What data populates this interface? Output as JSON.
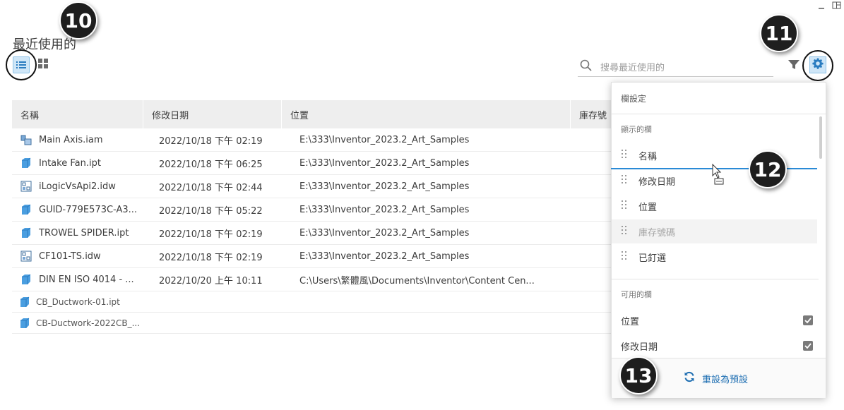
{
  "window": {
    "minimize_icon": "minimize-icon",
    "restore_icon": "restore-icon"
  },
  "page_title": "最近使用的",
  "view_toggle": {
    "list_icon": "list-view-icon",
    "grid_icon": "grid-view-icon"
  },
  "search": {
    "placeholder": "搜尋最近使用的"
  },
  "callouts": {
    "c10": "10",
    "c11": "11",
    "c12": "12",
    "c13": "13"
  },
  "table": {
    "headers": {
      "name": "名稱",
      "modified": "修改日期",
      "location": "位置",
      "part_no": "庫存號"
    },
    "rows": [
      {
        "icon": "assembly-icon",
        "name": "Main Axis.iam",
        "modified": "2022/10/18 下午 02:19",
        "location": "E:\\333\\Inventor_2023.2_Art_Samples"
      },
      {
        "icon": "part-icon",
        "name": "Intake Fan.ipt",
        "modified": "2022/10/18 下午 06:25",
        "location": "E:\\333\\Inventor_2023.2_Art_Samples"
      },
      {
        "icon": "drawing-icon",
        "name": "iLogicVsApi2.idw",
        "modified": "2022/10/18 下午 02:44",
        "location": "E:\\333\\Inventor_2023.2_Art_Samples"
      },
      {
        "icon": "part-icon",
        "name": "GUID-779E573C-A3...",
        "modified": "2022/10/18 下午 05:22",
        "location": "E:\\333\\Inventor_2023.2_Art_Samples"
      },
      {
        "icon": "part-icon",
        "name": "TROWEL SPIDER.ipt",
        "modified": "2022/10/18 下午 02:19",
        "location": "E:\\333\\Inventor_2023.2_Art_Samples"
      },
      {
        "icon": "drawing-icon",
        "name": "CF101-TS.idw",
        "modified": "2022/10/18 下午 02:19",
        "location": "E:\\333\\Inventor_2023.2_Art_Samples"
      },
      {
        "icon": "part-icon",
        "name": "DIN EN ISO 4014 - ...",
        "modified": "2022/10/20 上午 10:11",
        "location": "C:\\Users\\繁體風\\Documents\\Inventor\\Content Cen..."
      }
    ],
    "small_rows": [
      {
        "icon": "part-icon",
        "name": "CB_Ductwork-01.ipt"
      },
      {
        "icon": "part-icon",
        "name": "CB-Ductwork-2022CB_..."
      }
    ]
  },
  "column_settings": {
    "title": "欄設定",
    "visible_label": "顯示的欄",
    "visible_columns": [
      {
        "label": "名稱",
        "enabled": true
      },
      {
        "label": "修改日期",
        "enabled": true
      },
      {
        "label": "位置",
        "enabled": true
      },
      {
        "label": "庫存號碼",
        "enabled": false
      },
      {
        "label": "已釘選",
        "enabled": true
      }
    ],
    "available_label": "可用的欄",
    "available_columns": [
      {
        "label": "位置",
        "checked": true
      },
      {
        "label": "修改日期",
        "checked": true
      }
    ],
    "reset_label": "重設為預設"
  },
  "colors": {
    "accent": "#1f6fb2",
    "selected_bg": "#cfe6f7",
    "drop_line": "#2a8ad6"
  }
}
